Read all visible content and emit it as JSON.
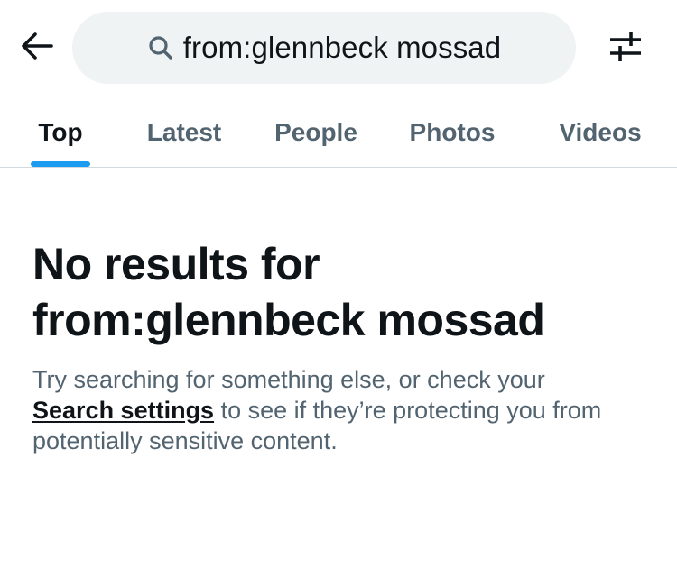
{
  "header": {
    "back_icon": "arrow-left-icon",
    "search_icon": "search-icon",
    "query": "from:glennbeck mossad",
    "filter_icon": "sliders-icon"
  },
  "tabs": [
    {
      "label": "Top",
      "active": true
    },
    {
      "label": "Latest",
      "active": false
    },
    {
      "label": "People",
      "active": false
    },
    {
      "label": "Photos",
      "active": false
    },
    {
      "label": "Videos",
      "active": false
    }
  ],
  "empty_state": {
    "title_line1": "No results for",
    "title_line2": "from:glennbeck mossad",
    "body_before": "Try searching for something else, or check your",
    "link_label": "Search settings",
    "body_after": " to see if they’re protecting you from potentially sensitive content."
  },
  "colors": {
    "accent": "#1d9bf0",
    "text_primary": "#0f1419",
    "text_secondary": "#536471",
    "pill_bg": "#eff3f4",
    "divider": "#cfd9de"
  }
}
